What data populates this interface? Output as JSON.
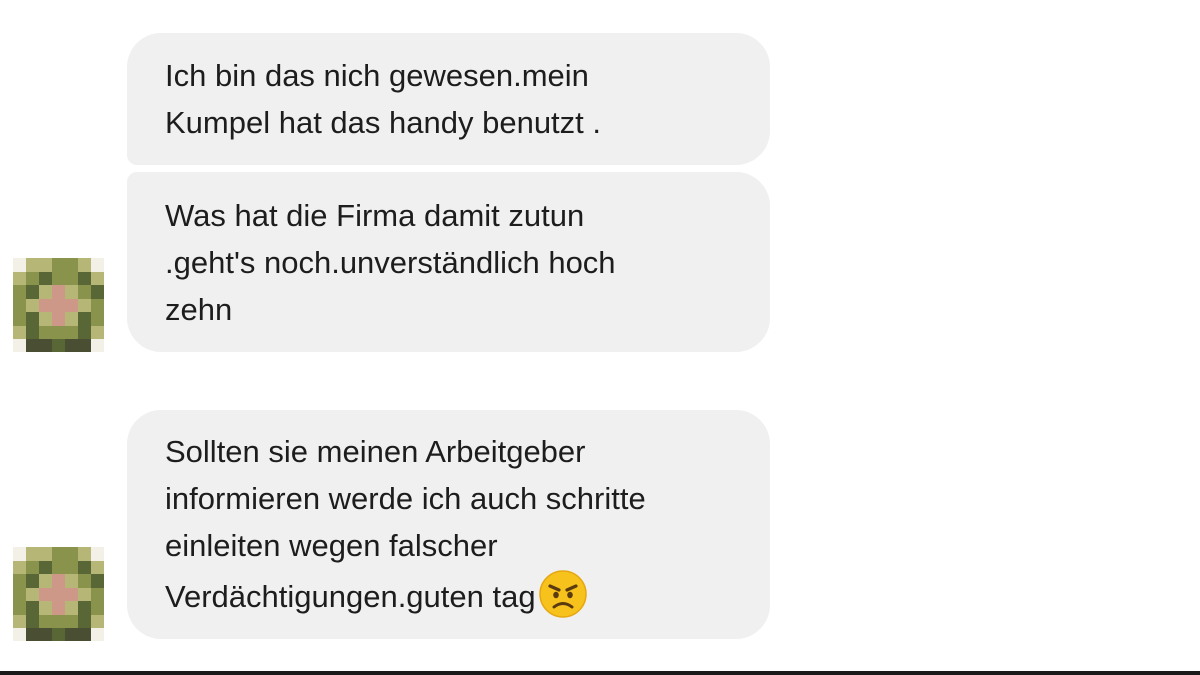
{
  "messages": [
    {
      "text": "Ich bin das nich gewesen.mein\nKumpel hat das handy benutzt ."
    },
    {
      "text": "Was hat die Firma damit zutun\n.geht's noch.unverständlich hoch\nzehn"
    },
    {
      "text": "Sollten sie meinen Arbeitgeber\ninformieren werde ich auch schritte\neinleiten wegen falscher\nVerdächtigungen.guten tag",
      "emoji": "angry-face-icon"
    }
  ],
  "colors": {
    "bubble_background": "#f0f0f0",
    "text": "#1d1d1d",
    "page_background": "#ffffff",
    "emoji_face": "#f7c21c",
    "avatar_dark": "#4a5a24",
    "avatar_mid": "#7f8a3c",
    "avatar_light": "#b0b06a",
    "avatar_pink": "#c98f7e"
  }
}
